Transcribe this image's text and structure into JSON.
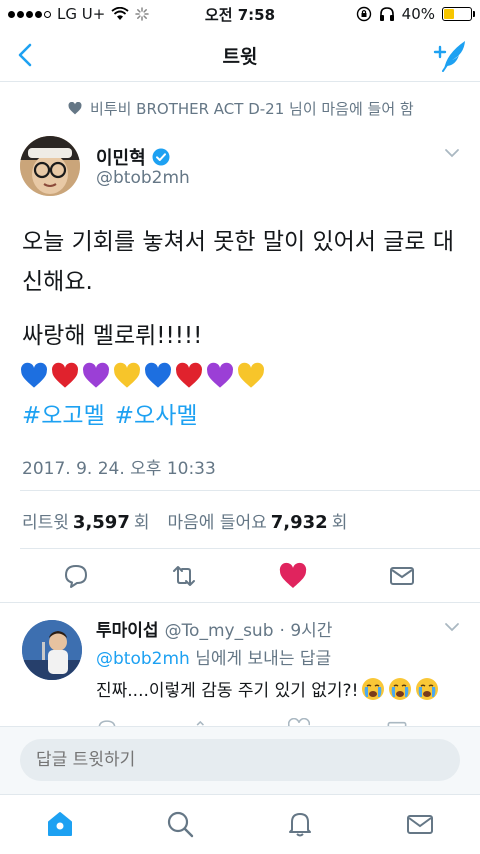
{
  "status_bar": {
    "carrier": "LG U+",
    "time": "오전 7:58",
    "battery": "40%",
    "battery_level": 0.4
  },
  "nav": {
    "title": "트윗",
    "back_icon": "back-chevron-icon",
    "compose_icon": "compose-tweet-icon"
  },
  "context": {
    "text": "비투비 BROTHER ACT D-21 님이 마음에 들어 함",
    "icon": "heart-icon"
  },
  "author": {
    "name": "이민혁",
    "handle": "@btob2mh",
    "verified": true
  },
  "tweet": {
    "line1": "오늘 기회를 놓쳐서 못한 말이 있어서 글로 대신해요.",
    "line2": "싸랑해 멜로뤼!!!!!",
    "hearts": [
      "blue",
      "red",
      "purple",
      "yellow",
      "blue",
      "red",
      "purple",
      "yellow"
    ],
    "hashtags": [
      "#오고멜",
      "#오사멜"
    ],
    "timestamp": "2017. 9. 24. 오후 10:33"
  },
  "stats": {
    "retweets_label": "리트윗",
    "retweets": "3,597",
    "unit1": "회",
    "likes_label": "마음에 들어요",
    "likes": "7,932",
    "unit2": "회"
  },
  "actions": [
    "reply-icon",
    "retweet-icon",
    "like-icon",
    "share-icon"
  ],
  "reply": {
    "name": "투마이섭",
    "handle": "@To_my_sub",
    "time": "· 9시간",
    "to_mention": "@btob2mh",
    "to_suffix": " 님에게 보내는 답글",
    "text": "진짜....이렇게 감동 주기 있기 없기?!",
    "emoji": [
      "crying-face",
      "crying-face",
      "crying-face"
    ]
  },
  "composer": {
    "placeholder": "답글 트윗하기"
  },
  "tabs": [
    "home-icon",
    "search-icon",
    "notifications-icon",
    "messages-icon"
  ],
  "colors": {
    "accent": "#1da1f2",
    "like": "#e0245e",
    "secondary_text": "#657786"
  }
}
